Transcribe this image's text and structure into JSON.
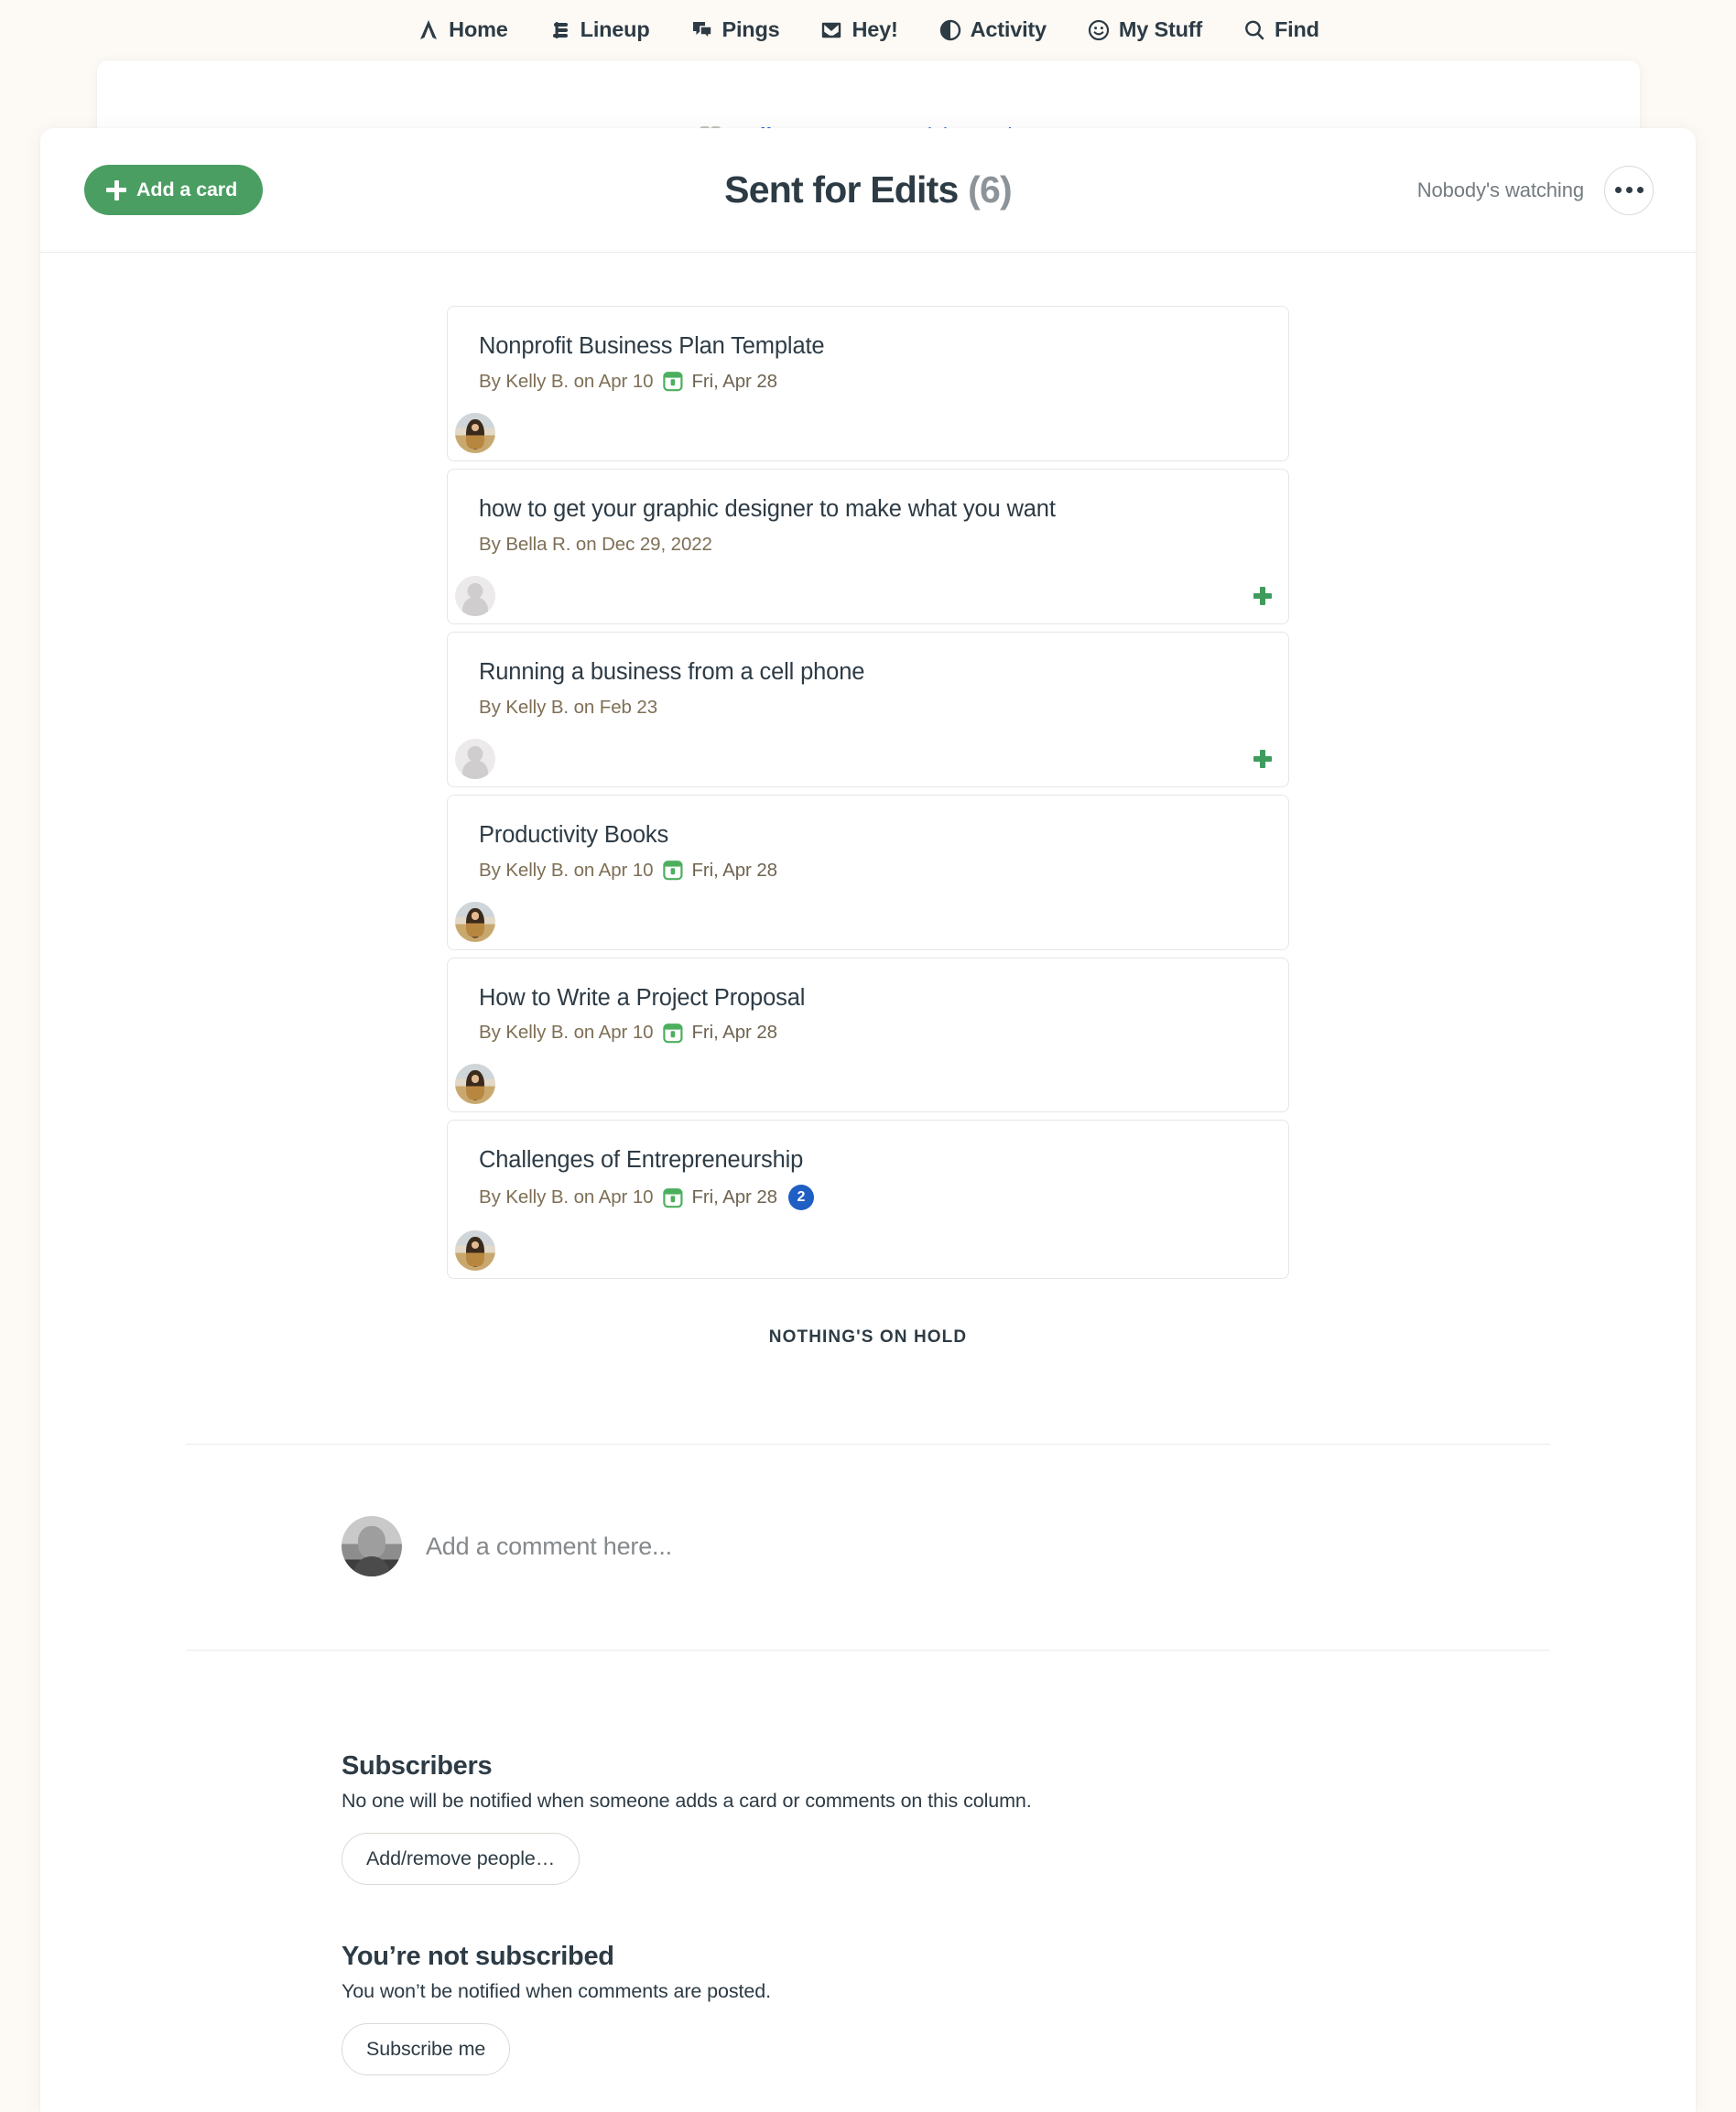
{
  "nav": {
    "items": [
      {
        "label": "Home",
        "icon": "home-icon"
      },
      {
        "label": "Lineup",
        "icon": "lineup-icon"
      },
      {
        "label": "Pings",
        "icon": "pings-icon"
      },
      {
        "label": "Hey!",
        "icon": "hey-inbox-icon"
      },
      {
        "label": "Activity",
        "icon": "activity-icon"
      },
      {
        "label": "My Stuff",
        "icon": "my-stuff-smiley-icon"
      },
      {
        "label": "Find",
        "icon": "search-icon"
      }
    ]
  },
  "breadcrumb": {
    "grid_icon": "grid-icon",
    "project": "Bella Content",
    "separator": "›",
    "current": "Article Tracker"
  },
  "header": {
    "add_card_label": "Add a card",
    "title": "Sent for Edits",
    "count": "(6)",
    "watching": "Nobody's watching",
    "menu_icon": "more-options-icon"
  },
  "cards": [
    {
      "title": "Nonprofit Business Plan Template",
      "author": "By Kelly B. on Apr 10",
      "has_due": true,
      "due": "Fri, Apr 28",
      "comments": null,
      "avatar": "photo"
    },
    {
      "title": "how to get your graphic designer to make what you want",
      "author": "By Bella R. on Dec 29, 2022",
      "has_due": false,
      "due": "",
      "comments": null,
      "avatar": "placeholder"
    },
    {
      "title": "Running a business from a cell phone",
      "author": "By Kelly B. on Feb 23",
      "has_due": false,
      "due": "",
      "comments": null,
      "avatar": "placeholder"
    },
    {
      "title": "Productivity Books",
      "author": "By Kelly B. on Apr 10",
      "has_due": true,
      "due": "Fri, Apr 28",
      "comments": null,
      "avatar": "photo"
    },
    {
      "title": "How to Write a Project Proposal",
      "author": "By Kelly B. on Apr 10",
      "has_due": true,
      "due": "Fri, Apr 28",
      "comments": null,
      "avatar": "photo"
    },
    {
      "title": "Challenges of Entrepreneurship",
      "author": "By Kelly B. on Apr 10",
      "has_due": true,
      "due": "Fri, Apr 28",
      "comments": "2",
      "avatar": "photo"
    }
  ],
  "on_hold_text": "NOTHING'S ON HOLD",
  "comment": {
    "placeholder": "Add a comment here...",
    "avatar": "user-avatar"
  },
  "subscribers": {
    "heading": "Subscribers",
    "description": "No one will be notified when someone adds a card or comments on this column.",
    "button": "Add/remove people…"
  },
  "subscription": {
    "heading": "You’re not subscribed",
    "description": "You won’t be notified when comments are posted.",
    "button": "Subscribe me"
  },
  "colors": {
    "page_bg": "#fdfaf5",
    "accent_green": "#4a9e62",
    "link_blue": "#1d5fd0",
    "text_dark": "#2d3b45",
    "meta_brown": "#7e6f55",
    "badge_blue": "#1f5fc4"
  }
}
